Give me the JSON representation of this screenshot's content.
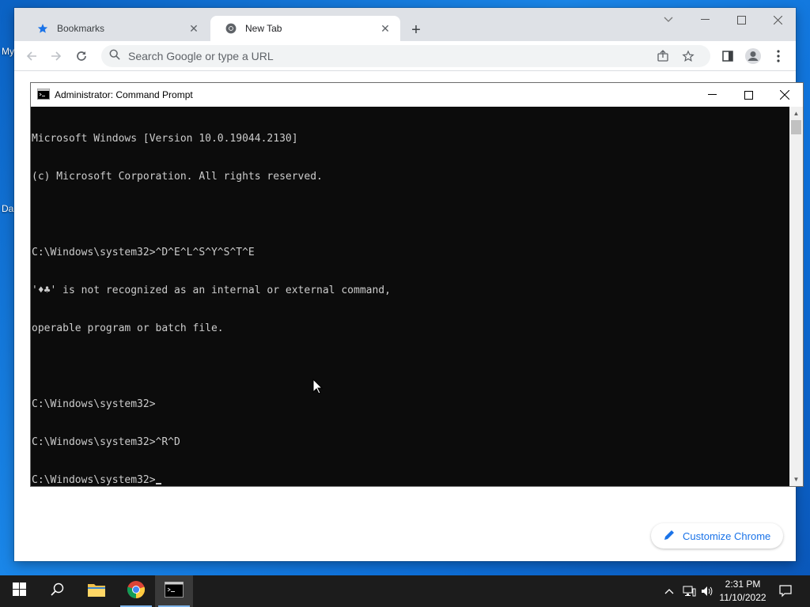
{
  "desktop": {
    "icon_labels": [
      "My",
      "Da"
    ]
  },
  "browser": {
    "tabs": [
      {
        "title": "Bookmarks",
        "icon": "star-icon",
        "active": false
      },
      {
        "title": "New Tab",
        "icon": "chrome-icon",
        "active": true
      }
    ],
    "omnibox": {
      "placeholder": "Search Google or type a URL"
    },
    "customize_label": "Customize Chrome",
    "accent": "#1a73e8"
  },
  "cmd": {
    "title": "Administrator: Command Prompt",
    "lines": [
      "Microsoft Windows [Version 10.0.19044.2130]",
      "(c) Microsoft Corporation. All rights reserved.",
      "",
      "C:\\Windows\\system32>^D^E^L^S^Y^S^T^E",
      "'♦♣' is not recognized as an internal or external command,",
      "operable program or batch file.",
      "",
      "C:\\Windows\\system32>",
      "C:\\Windows\\system32>^R^D",
      "C:\\Windows\\system32>"
    ]
  },
  "taskbar": {
    "items": [
      "start-icon",
      "search-icon",
      "file-explorer-icon",
      "chrome-icon",
      "command-prompt-icon"
    ],
    "clock": {
      "time": "2:31 PM",
      "date": "11/10/2022"
    }
  }
}
